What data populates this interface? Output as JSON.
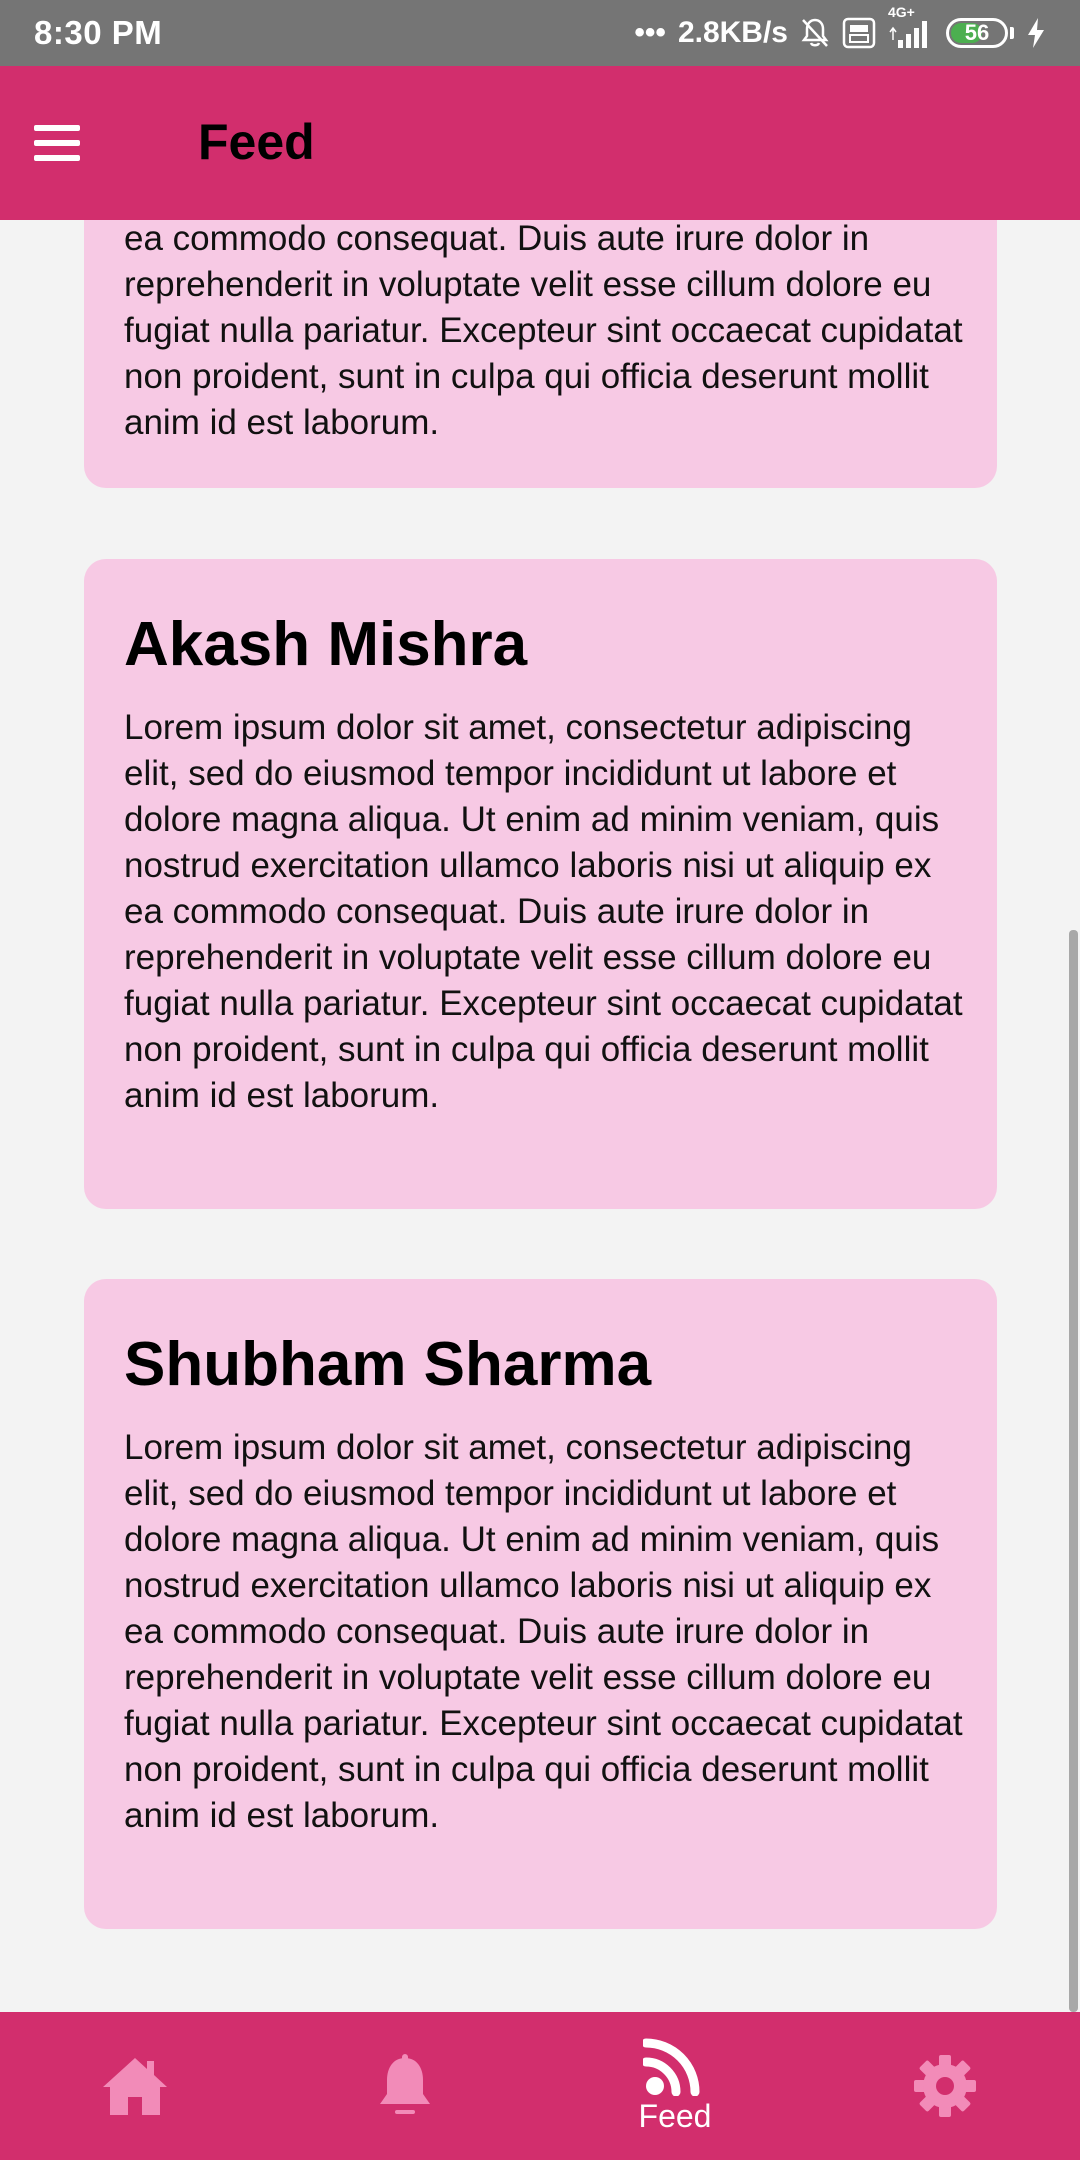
{
  "status_bar": {
    "time": "8:30 PM",
    "network_speed": "2.8KB/s",
    "signal_type": "4G+",
    "battery_level": "56"
  },
  "app_bar": {
    "title": "Feed"
  },
  "feed": {
    "posts": [
      {
        "name": "",
        "text": "ea commodo consequat. Duis aute irure dolor in reprehenderit in voluptate velit esse cillum dolore eu fugiat nulla pariatur. Excepteur sint occaecat cupidatat non proident, sunt in culpa qui officia deserunt mollit anim id est laborum."
      },
      {
        "name": "Akash Mishra",
        "text": "Lorem ipsum dolor sit amet, consectetur adipiscing elit, sed do eiusmod tempor incididunt ut labore et dolore magna aliqua. Ut enim ad minim veniam, quis nostrud exercitation ullamco laboris nisi ut aliquip ex ea commodo consequat. Duis aute irure dolor in reprehenderit in voluptate velit esse cillum dolore eu fugiat nulla pariatur. Excepteur sint occaecat cupidatat non proident, sunt in culpa qui officia deserunt mollit anim id est laborum."
      },
      {
        "name": "Shubham Sharma",
        "text": "Lorem ipsum dolor sit amet, consectetur adipiscing elit, sed do eiusmod tempor incididunt ut labore et dolore magna aliqua. Ut enim ad minim veniam, quis nostrud exercitation ullamco laboris nisi ut aliquip ex ea commodo consequat. Duis aute irure dolor in reprehenderit in voluptate velit esse cillum dolore eu fugiat nulla pariatur. Excepteur sint occaecat cupidatat non proident, sunt in culpa qui officia deserunt mollit anim id est laborum."
      }
    ]
  },
  "bottom_nav": {
    "items": [
      {
        "icon": "home-icon",
        "label": ""
      },
      {
        "icon": "bell-icon",
        "label": ""
      },
      {
        "icon": "rss-feed-icon",
        "label": "Feed"
      },
      {
        "icon": "gear-icon",
        "label": ""
      }
    ]
  },
  "colors": {
    "status_bar": "#757575",
    "primary": "#d22e6d",
    "card_background": "#f7c9e4",
    "page_background": "#f3f3f3",
    "inactive_icon": "#f28bb8",
    "active_icon": "#ffffff",
    "battery": "#4caf50"
  }
}
